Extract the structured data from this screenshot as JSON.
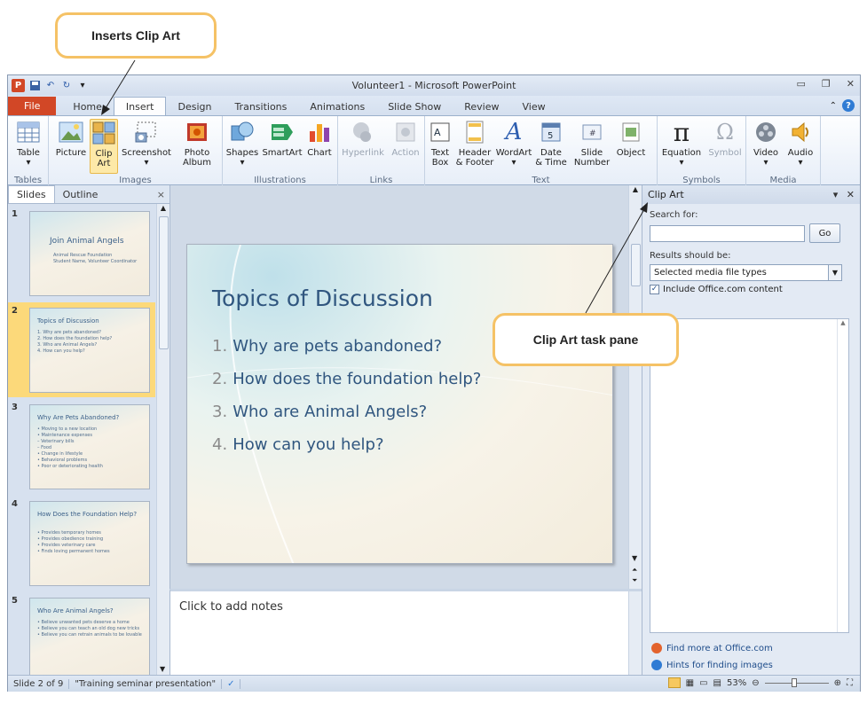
{
  "callouts": {
    "inserts_clip_art": "Inserts Clip Art",
    "task_pane": "Clip Art task pane"
  },
  "window": {
    "title": "Volunteer1 - Microsoft PowerPoint",
    "app_icon": "P"
  },
  "tabs": [
    "File",
    "Home",
    "Insert",
    "Design",
    "Transitions",
    "Animations",
    "Slide Show",
    "Review",
    "View"
  ],
  "ribbon": {
    "tables": {
      "label": "Tables",
      "table": "Table"
    },
    "images": {
      "label": "Images",
      "picture": "Picture",
      "clip_art_1": "Clip",
      "clip_art_2": "Art",
      "screenshot": "Screenshot",
      "photo_album_1": "Photo",
      "photo_album_2": "Album"
    },
    "illustrations": {
      "label": "Illustrations",
      "shapes": "Shapes",
      "smartart": "SmartArt",
      "chart": "Chart"
    },
    "links": {
      "label": "Links",
      "hyperlink": "Hyperlink",
      "action": "Action"
    },
    "text": {
      "label": "Text",
      "text_box_1": "Text",
      "text_box_2": "Box",
      "header_1": "Header",
      "header_2": "& Footer",
      "wordart": "WordArt",
      "date_1": "Date",
      "date_2": "& Time",
      "slide_num_1": "Slide",
      "slide_num_2": "Number",
      "object": "Object"
    },
    "symbols": {
      "label": "Symbols",
      "equation": "Equation",
      "symbol": "Symbol"
    },
    "media": {
      "label": "Media",
      "video": "Video",
      "audio": "Audio"
    }
  },
  "slides_pane": {
    "tab_slides": "Slides",
    "tab_outline": "Outline",
    "close": "×",
    "thumbs": [
      {
        "num": "1",
        "title": "Join Animal Angels",
        "body": "Animal Rescue Foundation\nStudent Name, Volunteer Coordinator"
      },
      {
        "num": "2",
        "title": "Topics of Discussion",
        "body": "1. Why are pets abandoned?\n2. How does the foundation help?\n3. Who are Animal Angels?\n4. How can you help?"
      },
      {
        "num": "3",
        "title": "Why Are Pets Abandoned?",
        "body": "• Moving to a new location\n• Maintenance expenses\n  – Veterinary bills\n  – Food\n• Change in lifestyle\n• Behavioral problems\n• Poor or deteriorating health"
      },
      {
        "num": "4",
        "title": "How Does the Foundation Help?",
        "body": "• Provides temporary homes\n• Provides obedience training\n• Provides veterinary care\n• Finds loving permanent homes"
      },
      {
        "num": "5",
        "title": "Who Are Animal Angels?",
        "body": "• Believe unwanted pets deserve a home\n• Believe you can teach an old dog new tricks\n• Believe you can retrain animals to be lovable"
      }
    ]
  },
  "slide": {
    "title": "Topics of Discussion",
    "items": [
      {
        "n": "1.",
        "text": "Why are pets abandoned?"
      },
      {
        "n": "2.",
        "text": "How does the foundation help?"
      },
      {
        "n": "3.",
        "text": "Who are Animal Angels?"
      },
      {
        "n": "4.",
        "text": "How can you help?"
      }
    ]
  },
  "notes": {
    "placeholder": "Click to add notes"
  },
  "task_pane": {
    "title": "Clip Art",
    "search_label": "Search for:",
    "search_value": "",
    "go": "Go",
    "results_label": "Results should be:",
    "results_value": "Selected media file types",
    "include_label": "Include Office.com content",
    "link_more": "Find more at Office.com",
    "link_hints": "Hints for finding images"
  },
  "status": {
    "slide_count": "Slide 2 of 9",
    "theme": "\"Training seminar presentation\"",
    "zoom": "53%"
  }
}
